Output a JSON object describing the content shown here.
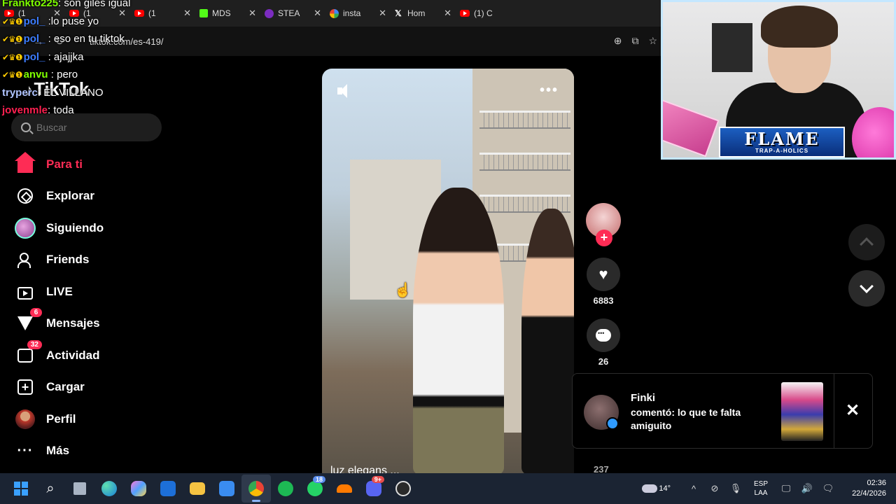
{
  "browser": {
    "tabs": [
      {
        "label": "(1 ",
        "icon": "youtube-icon"
      },
      {
        "label": "(1 ",
        "icon": "youtube-icon"
      },
      {
        "label": "(1 ",
        "icon": "youtube-icon"
      },
      {
        "label": "MDS",
        "icon": "kick-icon"
      },
      {
        "label": "STEA",
        "icon": "steam-icon"
      },
      {
        "label": "insta",
        "icon": "google-icon"
      },
      {
        "label": "Hom",
        "icon": "x-icon"
      },
      {
        "label": "(1) C",
        "icon": "youtube-icon"
      }
    ],
    "url": "tiktok.com/es-419/"
  },
  "chat": [
    {
      "user": "Frankto225",
      "message": ": son giles igual",
      "color": "#7fff00",
      "badges": ""
    },
    {
      "user": "pol_",
      "message": " :lo puse yo",
      "color": "#3d7dff",
      "badges": "✔♛❶"
    },
    {
      "user": "pol_",
      "message": " : eso en tu tiktok",
      "color": "#3d7dff",
      "badges": "✔♛❶"
    },
    {
      "user": "pol_",
      "message": " : ajajjka",
      "color": "#3d7dff",
      "badges": "✔♛❶"
    },
    {
      "user": "anvu",
      "message": " : pero",
      "color": "#7fff00",
      "badges": "✔♛❶"
    },
    {
      "user": "tryperc",
      "message": ": EL VILLANO",
      "color": "#b0c4ff",
      "badges": ""
    },
    {
      "user": "jovenmle",
      "message": ": toda",
      "color": "#ff2050",
      "badges": ""
    }
  ],
  "tiktok": {
    "logo": "TikTok",
    "search_placeholder": "Buscar",
    "nav": [
      {
        "label": "Para ti",
        "icon": "home-icon",
        "active": true,
        "badge": ""
      },
      {
        "label": "Explorar",
        "icon": "compass-icon",
        "active": false,
        "badge": ""
      },
      {
        "label": "Siguiendo",
        "icon": "following-avatar-icon",
        "active": false,
        "badge": ""
      },
      {
        "label": "Friends",
        "icon": "friends-icon",
        "active": false,
        "badge": ""
      },
      {
        "label": "LIVE",
        "icon": "live-icon",
        "active": false,
        "badge": ""
      },
      {
        "label": "Mensajes",
        "icon": "messages-icon",
        "active": false,
        "badge": "6"
      },
      {
        "label": "Actividad",
        "icon": "activity-icon",
        "active": false,
        "badge": "32"
      },
      {
        "label": "Cargar",
        "icon": "upload-icon",
        "active": false,
        "badge": ""
      },
      {
        "label": "Perfil",
        "icon": "profile-avatar-icon",
        "active": false,
        "badge": ""
      },
      {
        "label": "Más",
        "icon": "more-icon",
        "active": false,
        "badge": ""
      }
    ],
    "video": {
      "caption_fragment": "luz elegans ..."
    },
    "actions": {
      "likes": "6883",
      "comments": "26",
      "shares_partial": "237"
    },
    "notification": {
      "name": "Finki",
      "text": "comentó: lo que te falta amiguito"
    }
  },
  "webcam": {
    "banner_title": "FLAME",
    "banner_sub": "TRAP-A-HOLICS"
  },
  "taskbar": {
    "weather_temp": "14°",
    "lang_line1": "ESP",
    "lang_line2": "LAA",
    "time": "02:36",
    "date": "22/4/2026",
    "whatsapp_badge": "18",
    "discord_badge": "9+"
  }
}
